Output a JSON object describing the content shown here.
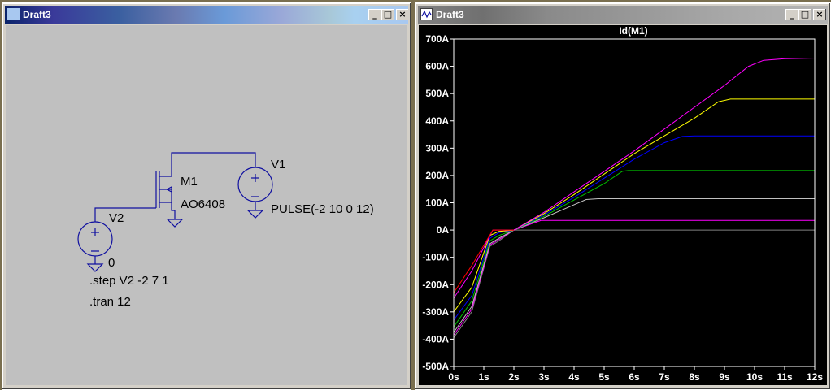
{
  "schematic_window": {
    "title": "Draft3",
    "controls": {
      "minimize": "_",
      "maximize": "□",
      "close": "×"
    },
    "components": {
      "m1_name": "M1",
      "m1_model": "AO6408",
      "v1_name": "V1",
      "v1_value": "PULSE(-2 10 0 12)",
      "v2_name": "V2",
      "ground_label": "0"
    },
    "directives": {
      "step": ".step V2  -2 7 1",
      "tran": ".tran 12"
    },
    "colors": {
      "wire": "#1010a0",
      "background": "#c0c0c0"
    }
  },
  "plot_window": {
    "title": "Draft3",
    "controls": {
      "minimize": "_",
      "maximize": "□",
      "close": "×"
    },
    "colors": {
      "background": "#000000",
      "axis": "#ffffff"
    }
  },
  "chart_data": {
    "type": "line",
    "title": "Id(M1)",
    "title_color": "#00ff00",
    "xlabel": "",
    "ylabel": "",
    "xlim": [
      0,
      12
    ],
    "ylim": [
      -500,
      700
    ],
    "x_ticks": [
      {
        "v": 0,
        "label": "0s"
      },
      {
        "v": 1,
        "label": "1s"
      },
      {
        "v": 2,
        "label": "2s"
      },
      {
        "v": 3,
        "label": "3s"
      },
      {
        "v": 4,
        "label": "4s"
      },
      {
        "v": 5,
        "label": "5s"
      },
      {
        "v": 6,
        "label": "6s"
      },
      {
        "v": 7,
        "label": "7s"
      },
      {
        "v": 8,
        "label": "8s"
      },
      {
        "v": 9,
        "label": "9s"
      },
      {
        "v": 10,
        "label": "10s"
      },
      {
        "v": 11,
        "label": "11s"
      },
      {
        "v": 12,
        "label": "12s"
      }
    ],
    "y_ticks": [
      {
        "v": 700,
        "label": "700A"
      },
      {
        "v": 600,
        "label": "600A"
      },
      {
        "v": 500,
        "label": "500A"
      },
      {
        "v": 400,
        "label": "400A"
      },
      {
        "v": 300,
        "label": "300A"
      },
      {
        "v": 200,
        "label": "200A"
      },
      {
        "v": 100,
        "label": "100A"
      },
      {
        "v": 0,
        "label": "0A"
      },
      {
        "v": -100,
        "label": "-100A"
      },
      {
        "v": -200,
        "label": "-200A"
      },
      {
        "v": -300,
        "label": "-300A"
      },
      {
        "v": -400,
        "label": "-400A"
      },
      {
        "v": -500,
        "label": "-500A"
      }
    ],
    "grid": false,
    "series": [
      {
        "color": "#808080",
        "points": [
          [
            0,
            -395
          ],
          [
            0.6,
            -300
          ],
          [
            1.2,
            -60
          ],
          [
            1.5,
            -40
          ],
          [
            2.0,
            0
          ],
          [
            12,
            0
          ]
        ]
      },
      {
        "color": "#ff00ff",
        "points": [
          [
            0,
            -385
          ],
          [
            0.6,
            -290
          ],
          [
            1.2,
            -55
          ],
          [
            1.5,
            -35
          ],
          [
            2.0,
            0
          ],
          [
            2.9,
            35
          ],
          [
            3.1,
            35
          ],
          [
            12,
            35
          ]
        ]
      },
      {
        "color": "#c0c0c0",
        "points": [
          [
            0,
            -375
          ],
          [
            0.6,
            -280
          ],
          [
            1.2,
            -50
          ],
          [
            1.5,
            -30
          ],
          [
            2.0,
            0
          ],
          [
            3.0,
            45
          ],
          [
            4.4,
            112
          ],
          [
            4.8,
            115
          ],
          [
            12,
            115
          ]
        ]
      },
      {
        "color": "#00c000",
        "points": [
          [
            0,
            -355
          ],
          [
            0.6,
            -260
          ],
          [
            1.2,
            -40
          ],
          [
            1.5,
            -20
          ],
          [
            2.0,
            0
          ],
          [
            3.0,
            50
          ],
          [
            4.0,
            110
          ],
          [
            5.0,
            170
          ],
          [
            5.6,
            215
          ],
          [
            5.8,
            218
          ],
          [
            12,
            218
          ]
        ]
      },
      {
        "color": "#0000ff",
        "points": [
          [
            0,
            -330
          ],
          [
            0.6,
            -240
          ],
          [
            1.2,
            -30
          ],
          [
            1.5,
            -10
          ],
          [
            2.0,
            0
          ],
          [
            3.0,
            55
          ],
          [
            4.0,
            120
          ],
          [
            5.0,
            190
          ],
          [
            6.0,
            260
          ],
          [
            7.0,
            320
          ],
          [
            7.6,
            343
          ],
          [
            8.0,
            345
          ],
          [
            12,
            345
          ]
        ]
      },
      {
        "color": "#ffff00",
        "points": [
          [
            0,
            -300
          ],
          [
            0.6,
            -210
          ],
          [
            1.2,
            -20
          ],
          [
            1.5,
            -5
          ],
          [
            2.0,
            0
          ],
          [
            3.0,
            60
          ],
          [
            4.0,
            130
          ],
          [
            5.0,
            205
          ],
          [
            6.0,
            280
          ],
          [
            7.0,
            345
          ],
          [
            8.0,
            410
          ],
          [
            8.8,
            470
          ],
          [
            9.2,
            480
          ],
          [
            12,
            480
          ]
        ]
      },
      {
        "color": "#ff00ff",
        "points": [
          [
            0,
            -250
          ],
          [
            0.6,
            -150
          ],
          [
            1.3,
            0
          ],
          [
            1.6,
            0
          ],
          [
            2.0,
            0
          ],
          [
            3.0,
            65
          ],
          [
            4.0,
            140
          ],
          [
            5.0,
            215
          ],
          [
            6.0,
            290
          ],
          [
            7.0,
            370
          ],
          [
            8.0,
            450
          ],
          [
            9.0,
            530
          ],
          [
            9.8,
            600
          ],
          [
            10.3,
            622
          ],
          [
            11,
            628
          ],
          [
            12,
            630
          ]
        ]
      },
      {
        "color": "#ff0000",
        "points": [
          [
            0,
            -230
          ],
          [
            0.6,
            -130
          ],
          [
            1.3,
            0
          ],
          [
            1.6,
            0
          ],
          [
            2.0,
            0
          ]
        ]
      }
    ]
  }
}
